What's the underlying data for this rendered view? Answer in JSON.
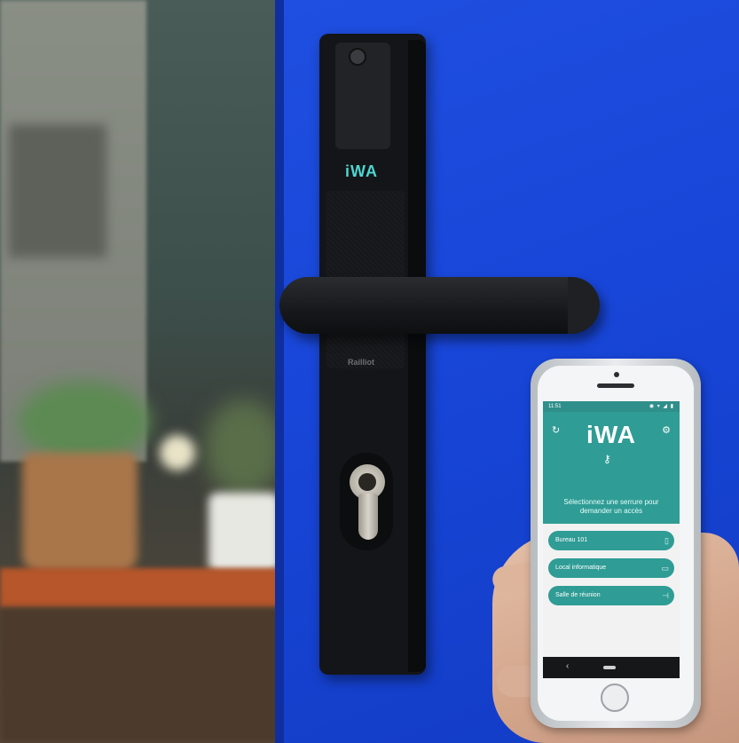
{
  "lock": {
    "brand_logo": "iWA",
    "brand_small": "Railliot"
  },
  "phone": {
    "status": {
      "time": "11:51",
      "icons": "◉ ▾ ◢ ▮"
    },
    "app": {
      "logo": "iWA",
      "prompt": "Sélectionnez une serrure pour demander un accès",
      "locks": [
        {
          "label": "Bureau 101"
        },
        {
          "label": "Local informatique"
        },
        {
          "label": "Salle de réunion"
        }
      ]
    }
  },
  "colors": {
    "door": "#1a4ad8",
    "app_teal": "#2f9c95"
  },
  "icons": {
    "refresh": "refresh-icon",
    "settings": "gear-icon",
    "key": "key-icon"
  }
}
